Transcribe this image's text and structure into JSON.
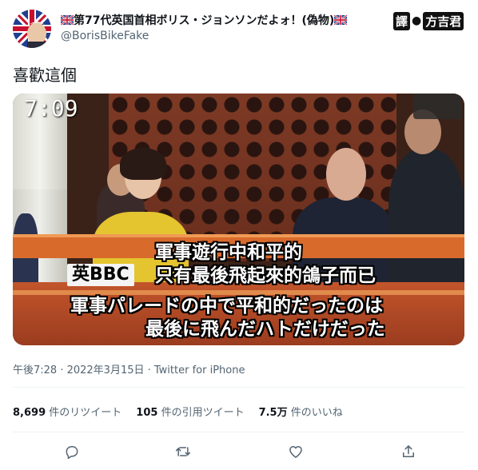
{
  "author": {
    "display_name": "第77代英国首相ボリス・ジョンソンだよォ！(偽物)",
    "handle": "@BorisBikeFake"
  },
  "translator_badge": {
    "stamp": "譯",
    "name": "方吉君"
  },
  "tweet": {
    "text": "喜歡這個",
    "posted": "午後7:28 · 2022年3月15日 · Twitter for iPhone"
  },
  "media": {
    "clock": "7:09",
    "subtitles": {
      "chinese_line1": "軍事遊行中和平的",
      "chinese_line2": "只有最後飛起來的鴿子而已",
      "source_label": "英BBC",
      "japanese_line1": "軍事パレードの中で平和的だったのは",
      "japanese_line2": "最後に飛んだハトだけだった"
    }
  },
  "stats": {
    "retweets_count": "8,699",
    "retweets_label": "件のリツイート",
    "quotes_count": "105",
    "quotes_label": "件の引用ツイート",
    "likes_count": "7.5万",
    "likes_label": "件のいいね"
  },
  "icons": {
    "reply": "reply-icon",
    "retweet": "retweet-icon",
    "like": "heart-icon",
    "share": "share-icon",
    "flag": "uk-flag-icon"
  },
  "colors": {
    "secondary_text": "#536471",
    "divider": "#eff3f4",
    "text": "#0f1419"
  }
}
